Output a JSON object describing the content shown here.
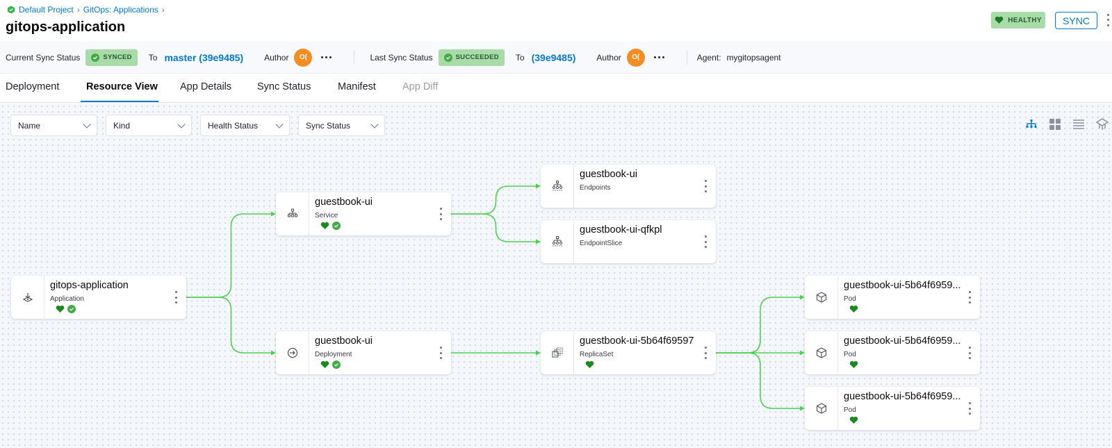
{
  "breadcrumb": [
    "Default Project",
    "GitOps: Applications"
  ],
  "page_title": "gitops-application",
  "health_label": "HEALTHY",
  "sync_button_label": "SYNC",
  "status_row": {
    "current_sync_label": "Current Sync Status",
    "current_sync_status": "SYNCED",
    "to_label": "To",
    "current_revision": "master (39e9485)",
    "author_label": "Author",
    "author_initials": "O(",
    "last_sync_label": "Last Sync Status",
    "last_sync_status": "SUCCEEDED",
    "last_revision": "(39e9485)",
    "agent_label": "Agent:",
    "agent_value": "mygitopsagent"
  },
  "tabs": [
    {
      "label": "Deployment",
      "state": "normal"
    },
    {
      "label": "Resource View",
      "state": "active"
    },
    {
      "label": "App Details",
      "state": "normal"
    },
    {
      "label": "Sync Status",
      "state": "normal"
    },
    {
      "label": "Manifest",
      "state": "normal"
    },
    {
      "label": "App Diff",
      "state": "disabled"
    }
  ],
  "filters": [
    "Name",
    "Kind",
    "Health Status",
    "Sync Status"
  ],
  "view_modes": [
    "tree-view-icon",
    "grid-view-icon",
    "list-view-icon",
    "network-view-icon"
  ],
  "active_view_mode": "tree-view-icon",
  "colors": {
    "accent": "#0278d5",
    "healthy": "#42ab45",
    "edge": "#4fcf4f",
    "author": "#f58c22"
  },
  "nodes": [
    {
      "id": "app",
      "name": "gitops-application",
      "kind": "Application",
      "icon": "application-icon",
      "health": true,
      "synced": true
    },
    {
      "id": "svc",
      "name": "guestbook-ui",
      "kind": "Service",
      "icon": "service-icon",
      "health": true,
      "synced": true
    },
    {
      "id": "dep",
      "name": "guestbook-ui",
      "kind": "Deployment",
      "icon": "deployment-icon",
      "health": true,
      "synced": true
    },
    {
      "id": "ep",
      "name": "guestbook-ui",
      "kind": "Endpoints",
      "icon": "endpoints-icon",
      "health": false,
      "synced": false
    },
    {
      "id": "eps",
      "name": "guestbook-ui-qfkpl",
      "kind": "EndpointSlice",
      "icon": "endpointslice-icon",
      "health": false,
      "synced": false
    },
    {
      "id": "rs",
      "name": "guestbook-ui-5b64f69597",
      "kind": "ReplicaSet",
      "icon": "replicaset-icon",
      "health": true,
      "synced": false
    },
    {
      "id": "pod1",
      "name": "guestbook-ui-5b64f6959...",
      "kind": "Pod",
      "icon": "pod-icon",
      "health": true,
      "synced": false
    },
    {
      "id": "pod2",
      "name": "guestbook-ui-5b64f6959...",
      "kind": "Pod",
      "icon": "pod-icon",
      "health": true,
      "synced": false
    },
    {
      "id": "pod3",
      "name": "guestbook-ui-5b64f6959...",
      "kind": "Pod",
      "icon": "pod-icon",
      "health": true,
      "synced": false
    }
  ],
  "edges": [
    [
      "app",
      "svc"
    ],
    [
      "app",
      "dep"
    ],
    [
      "svc",
      "ep"
    ],
    [
      "svc",
      "eps"
    ],
    [
      "dep",
      "rs"
    ],
    [
      "rs",
      "pod1"
    ],
    [
      "rs",
      "pod2"
    ],
    [
      "rs",
      "pod3"
    ]
  ]
}
